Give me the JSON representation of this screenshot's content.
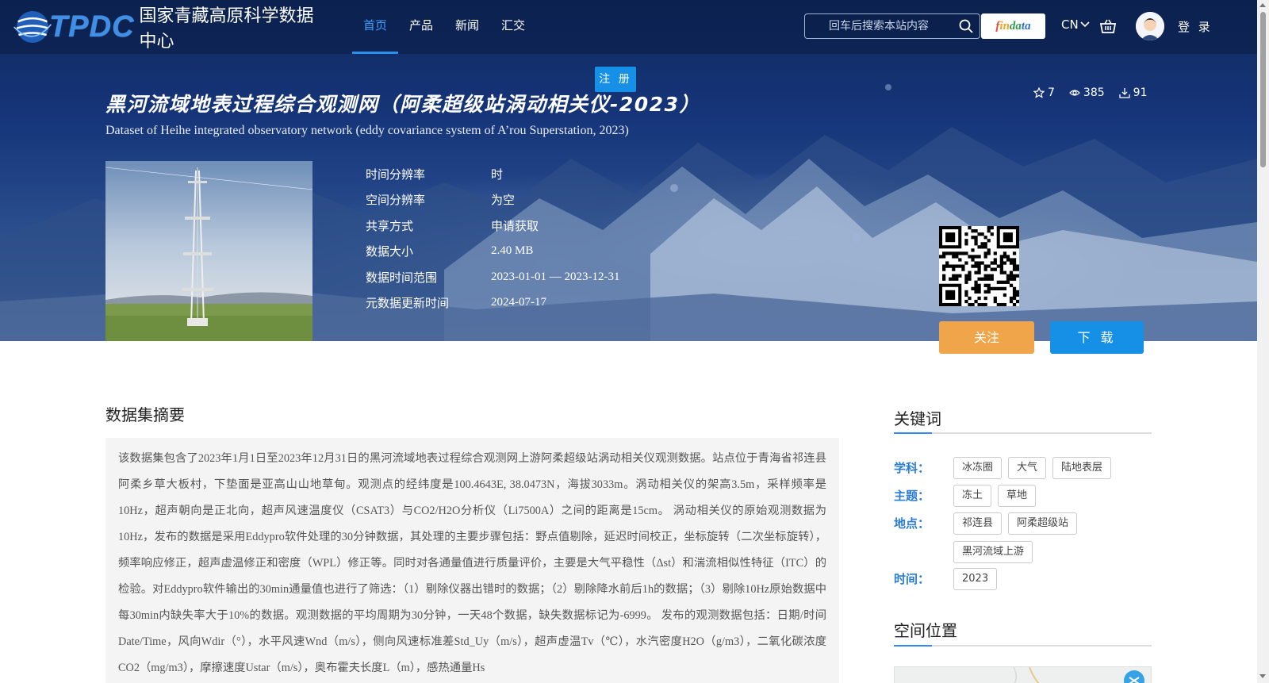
{
  "header": {
    "logo_text": "TPDC",
    "logo_cn": "国家青藏高原科学数据中心",
    "nav": [
      {
        "label": "首页",
        "active": true
      },
      {
        "label": "产品",
        "active": false
      },
      {
        "label": "新闻",
        "active": false
      },
      {
        "label": "汇交",
        "active": false
      }
    ],
    "search_placeholder": "回车后搜索本站内容",
    "findata": [
      "f",
      "in",
      "da",
      "ta"
    ],
    "lang": "CN",
    "login": "登 录"
  },
  "register_label": "注 册",
  "dataset": {
    "title_cn": "黑河流域地表过程综合观测网（阿柔超级站涡动相关仪-2023）",
    "title_en": "Dataset of Heihe integrated observatory network (eddy covariance system of A’rou Superstation, 2023)",
    "stats": {
      "stars": "7",
      "views": "385",
      "downloads": "91"
    },
    "info": [
      {
        "label": "时间分辨率",
        "value": "时"
      },
      {
        "label": "空间分辨率",
        "value": "为空"
      },
      {
        "label": "共享方式",
        "value": "申请获取"
      },
      {
        "label": "数据大小",
        "value": "2.40 MB"
      },
      {
        "label": "数据时间范围",
        "value": "2023-01-01 — 2023-12-31"
      },
      {
        "label": "元数据更新时间",
        "value": "2024-07-17"
      }
    ],
    "follow_label": "关注",
    "download_label": "下 载"
  },
  "abstract": {
    "title": "数据集摘要",
    "text": "该数据集包含了2023年1月1日至2023年12月31日的黑河流域地表过程综合观测网上游阿柔超级站涡动相关仪观测数据。站点位于青海省祁连县阿柔乡草大板村，下垫面是亚高山山地草甸。观测点的经纬度是100.4643E, 38.0473N，海拔3033m。涡动相关仪的架高3.5m，采样频率是10Hz，超声朝向是正北向，超声风速温度仪（CSAT3）与CO2/H2O分析仪（Li7500A）之间的距离是15cm。 涡动相关仪的原始观测数据为10Hz，发布的数据是采用Eddypro软件处理的30分钟数据，其处理的主要步骤包括：野点值剔除，延迟时间校正，坐标旋转（二次坐标旋转），频率响应修正，超声虚温修正和密度（WPL）修正等。同时对各通量值进行质量评价，主要是大气平稳性（Δst）和湍流相似性特征（ITC）的检验。对Eddypro软件输出的30min通量值也进行了筛选：（1）剔除仪器出错时的数据；（2）剔除降水前后1h的数据；（3）剔除10Hz原始数据中每30min内缺失率大于10%的数据。观测数据的平均周期为30分钟，一天48个数据，缺失数据标记为-6999。 发布的观测数据包括：日期/时间Date/Time，风向Wdir（°），水平风速Wnd（m/s），侧向风速标准差Std_Uy（m/s），超声虚温Tv（℃），水汽密度H2O（g/m3），二氧化碳浓度CO2（mg/m3），摩擦速度Ustar（m/s），奥布霍夫长度L（m），感热通量Hs"
  },
  "keywords": {
    "title": "关键词",
    "groups": [
      {
        "label": "学科：",
        "tags": [
          "冰冻圈",
          "大气",
          "陆地表层"
        ]
      },
      {
        "label": "主题：",
        "tags": [
          "冻土",
          "草地"
        ]
      },
      {
        "label": "地点：",
        "tags": [
          "祁连县",
          "阿柔超级站",
          "黑河流域上游"
        ]
      },
      {
        "label": "时间：",
        "tags": [
          "2023"
        ]
      }
    ]
  },
  "spatial": {
    "title": "空间位置"
  },
  "colors": {
    "accent": "#1590e6",
    "follow": "#f0a54a",
    "keyword_label": "#2b7cd6"
  }
}
